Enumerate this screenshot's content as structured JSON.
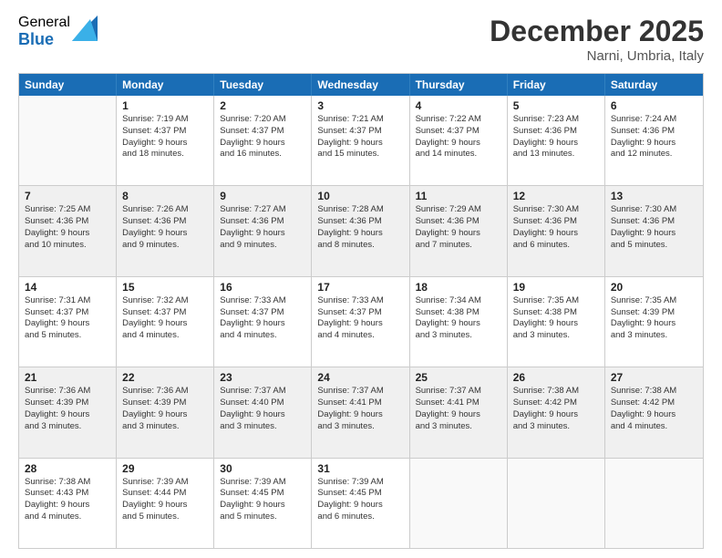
{
  "logo": {
    "general": "General",
    "blue": "Blue"
  },
  "title": "December 2025",
  "location": "Narni, Umbria, Italy",
  "days_header": [
    "Sunday",
    "Monday",
    "Tuesday",
    "Wednesday",
    "Thursday",
    "Friday",
    "Saturday"
  ],
  "weeks": [
    [
      {
        "day": "",
        "info": ""
      },
      {
        "day": "1",
        "info": "Sunrise: 7:19 AM\nSunset: 4:37 PM\nDaylight: 9 hours\nand 18 minutes."
      },
      {
        "day": "2",
        "info": "Sunrise: 7:20 AM\nSunset: 4:37 PM\nDaylight: 9 hours\nand 16 minutes."
      },
      {
        "day": "3",
        "info": "Sunrise: 7:21 AM\nSunset: 4:37 PM\nDaylight: 9 hours\nand 15 minutes."
      },
      {
        "day": "4",
        "info": "Sunrise: 7:22 AM\nSunset: 4:37 PM\nDaylight: 9 hours\nand 14 minutes."
      },
      {
        "day": "5",
        "info": "Sunrise: 7:23 AM\nSunset: 4:36 PM\nDaylight: 9 hours\nand 13 minutes."
      },
      {
        "day": "6",
        "info": "Sunrise: 7:24 AM\nSunset: 4:36 PM\nDaylight: 9 hours\nand 12 minutes."
      }
    ],
    [
      {
        "day": "7",
        "info": "Sunrise: 7:25 AM\nSunset: 4:36 PM\nDaylight: 9 hours\nand 10 minutes."
      },
      {
        "day": "8",
        "info": "Sunrise: 7:26 AM\nSunset: 4:36 PM\nDaylight: 9 hours\nand 9 minutes."
      },
      {
        "day": "9",
        "info": "Sunrise: 7:27 AM\nSunset: 4:36 PM\nDaylight: 9 hours\nand 9 minutes."
      },
      {
        "day": "10",
        "info": "Sunrise: 7:28 AM\nSunset: 4:36 PM\nDaylight: 9 hours\nand 8 minutes."
      },
      {
        "day": "11",
        "info": "Sunrise: 7:29 AM\nSunset: 4:36 PM\nDaylight: 9 hours\nand 7 minutes."
      },
      {
        "day": "12",
        "info": "Sunrise: 7:30 AM\nSunset: 4:36 PM\nDaylight: 9 hours\nand 6 minutes."
      },
      {
        "day": "13",
        "info": "Sunrise: 7:30 AM\nSunset: 4:36 PM\nDaylight: 9 hours\nand 5 minutes."
      }
    ],
    [
      {
        "day": "14",
        "info": "Sunrise: 7:31 AM\nSunset: 4:37 PM\nDaylight: 9 hours\nand 5 minutes."
      },
      {
        "day": "15",
        "info": "Sunrise: 7:32 AM\nSunset: 4:37 PM\nDaylight: 9 hours\nand 4 minutes."
      },
      {
        "day": "16",
        "info": "Sunrise: 7:33 AM\nSunset: 4:37 PM\nDaylight: 9 hours\nand 4 minutes."
      },
      {
        "day": "17",
        "info": "Sunrise: 7:33 AM\nSunset: 4:37 PM\nDaylight: 9 hours\nand 4 minutes."
      },
      {
        "day": "18",
        "info": "Sunrise: 7:34 AM\nSunset: 4:38 PM\nDaylight: 9 hours\nand 3 minutes."
      },
      {
        "day": "19",
        "info": "Sunrise: 7:35 AM\nSunset: 4:38 PM\nDaylight: 9 hours\nand 3 minutes."
      },
      {
        "day": "20",
        "info": "Sunrise: 7:35 AM\nSunset: 4:39 PM\nDaylight: 9 hours\nand 3 minutes."
      }
    ],
    [
      {
        "day": "21",
        "info": "Sunrise: 7:36 AM\nSunset: 4:39 PM\nDaylight: 9 hours\nand 3 minutes."
      },
      {
        "day": "22",
        "info": "Sunrise: 7:36 AM\nSunset: 4:39 PM\nDaylight: 9 hours\nand 3 minutes."
      },
      {
        "day": "23",
        "info": "Sunrise: 7:37 AM\nSunset: 4:40 PM\nDaylight: 9 hours\nand 3 minutes."
      },
      {
        "day": "24",
        "info": "Sunrise: 7:37 AM\nSunset: 4:41 PM\nDaylight: 9 hours\nand 3 minutes."
      },
      {
        "day": "25",
        "info": "Sunrise: 7:37 AM\nSunset: 4:41 PM\nDaylight: 9 hours\nand 3 minutes."
      },
      {
        "day": "26",
        "info": "Sunrise: 7:38 AM\nSunset: 4:42 PM\nDaylight: 9 hours\nand 3 minutes."
      },
      {
        "day": "27",
        "info": "Sunrise: 7:38 AM\nSunset: 4:42 PM\nDaylight: 9 hours\nand 4 minutes."
      }
    ],
    [
      {
        "day": "28",
        "info": "Sunrise: 7:38 AM\nSunset: 4:43 PM\nDaylight: 9 hours\nand 4 minutes."
      },
      {
        "day": "29",
        "info": "Sunrise: 7:39 AM\nSunset: 4:44 PM\nDaylight: 9 hours\nand 5 minutes."
      },
      {
        "day": "30",
        "info": "Sunrise: 7:39 AM\nSunset: 4:45 PM\nDaylight: 9 hours\nand 5 minutes."
      },
      {
        "day": "31",
        "info": "Sunrise: 7:39 AM\nSunset: 4:45 PM\nDaylight: 9 hours\nand 6 minutes."
      },
      {
        "day": "",
        "info": ""
      },
      {
        "day": "",
        "info": ""
      },
      {
        "day": "",
        "info": ""
      }
    ]
  ]
}
